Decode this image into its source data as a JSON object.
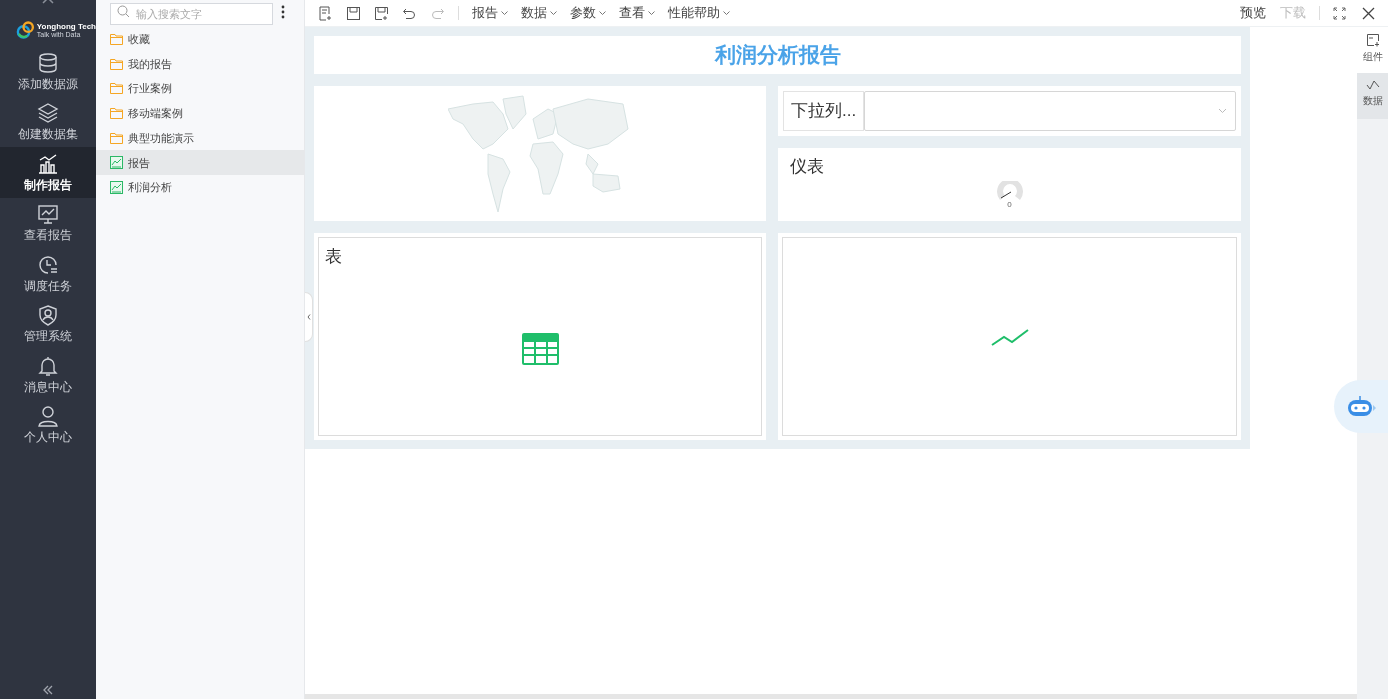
{
  "logo": {
    "name": "Yonghong Tech",
    "tagline": "Talk with Data"
  },
  "nav": [
    {
      "label": "添加数据源",
      "selected": false
    },
    {
      "label": "创建数据集",
      "selected": false
    },
    {
      "label": "制作报告",
      "selected": true
    },
    {
      "label": "查看报告",
      "selected": false
    },
    {
      "label": "调度任务",
      "selected": false
    },
    {
      "label": "管理系统",
      "selected": false
    },
    {
      "label": "消息中心",
      "selected": false
    },
    {
      "label": "个人中心",
      "selected": false
    }
  ],
  "search": {
    "placeholder": "输入搜索文字"
  },
  "tree": [
    {
      "label": "收藏",
      "kind": "folder",
      "selected": false
    },
    {
      "label": "我的报告",
      "kind": "folder",
      "selected": false
    },
    {
      "label": "行业案例",
      "kind": "folder",
      "selected": false
    },
    {
      "label": "移动端案例",
      "kind": "folder",
      "selected": false
    },
    {
      "label": "典型功能演示",
      "kind": "folder",
      "selected": false
    },
    {
      "label": "报告",
      "kind": "report",
      "selected": true
    },
    {
      "label": "利润分析",
      "kind": "report",
      "selected": false
    }
  ],
  "toolbar": {
    "menus": [
      "报告",
      "数据",
      "参数",
      "查看",
      "性能帮助"
    ],
    "right": [
      {
        "label": "预览",
        "disabled": false
      },
      {
        "label": "下载",
        "disabled": true
      }
    ]
  },
  "report": {
    "title": "利润分析报告",
    "dropdown_label": "下拉列...",
    "gauge_title": "仪表",
    "gauge_value": "0",
    "table_title": "表"
  },
  "right_panel": [
    {
      "label": "组件",
      "selected": false
    },
    {
      "label": "数据",
      "selected": true
    }
  ]
}
